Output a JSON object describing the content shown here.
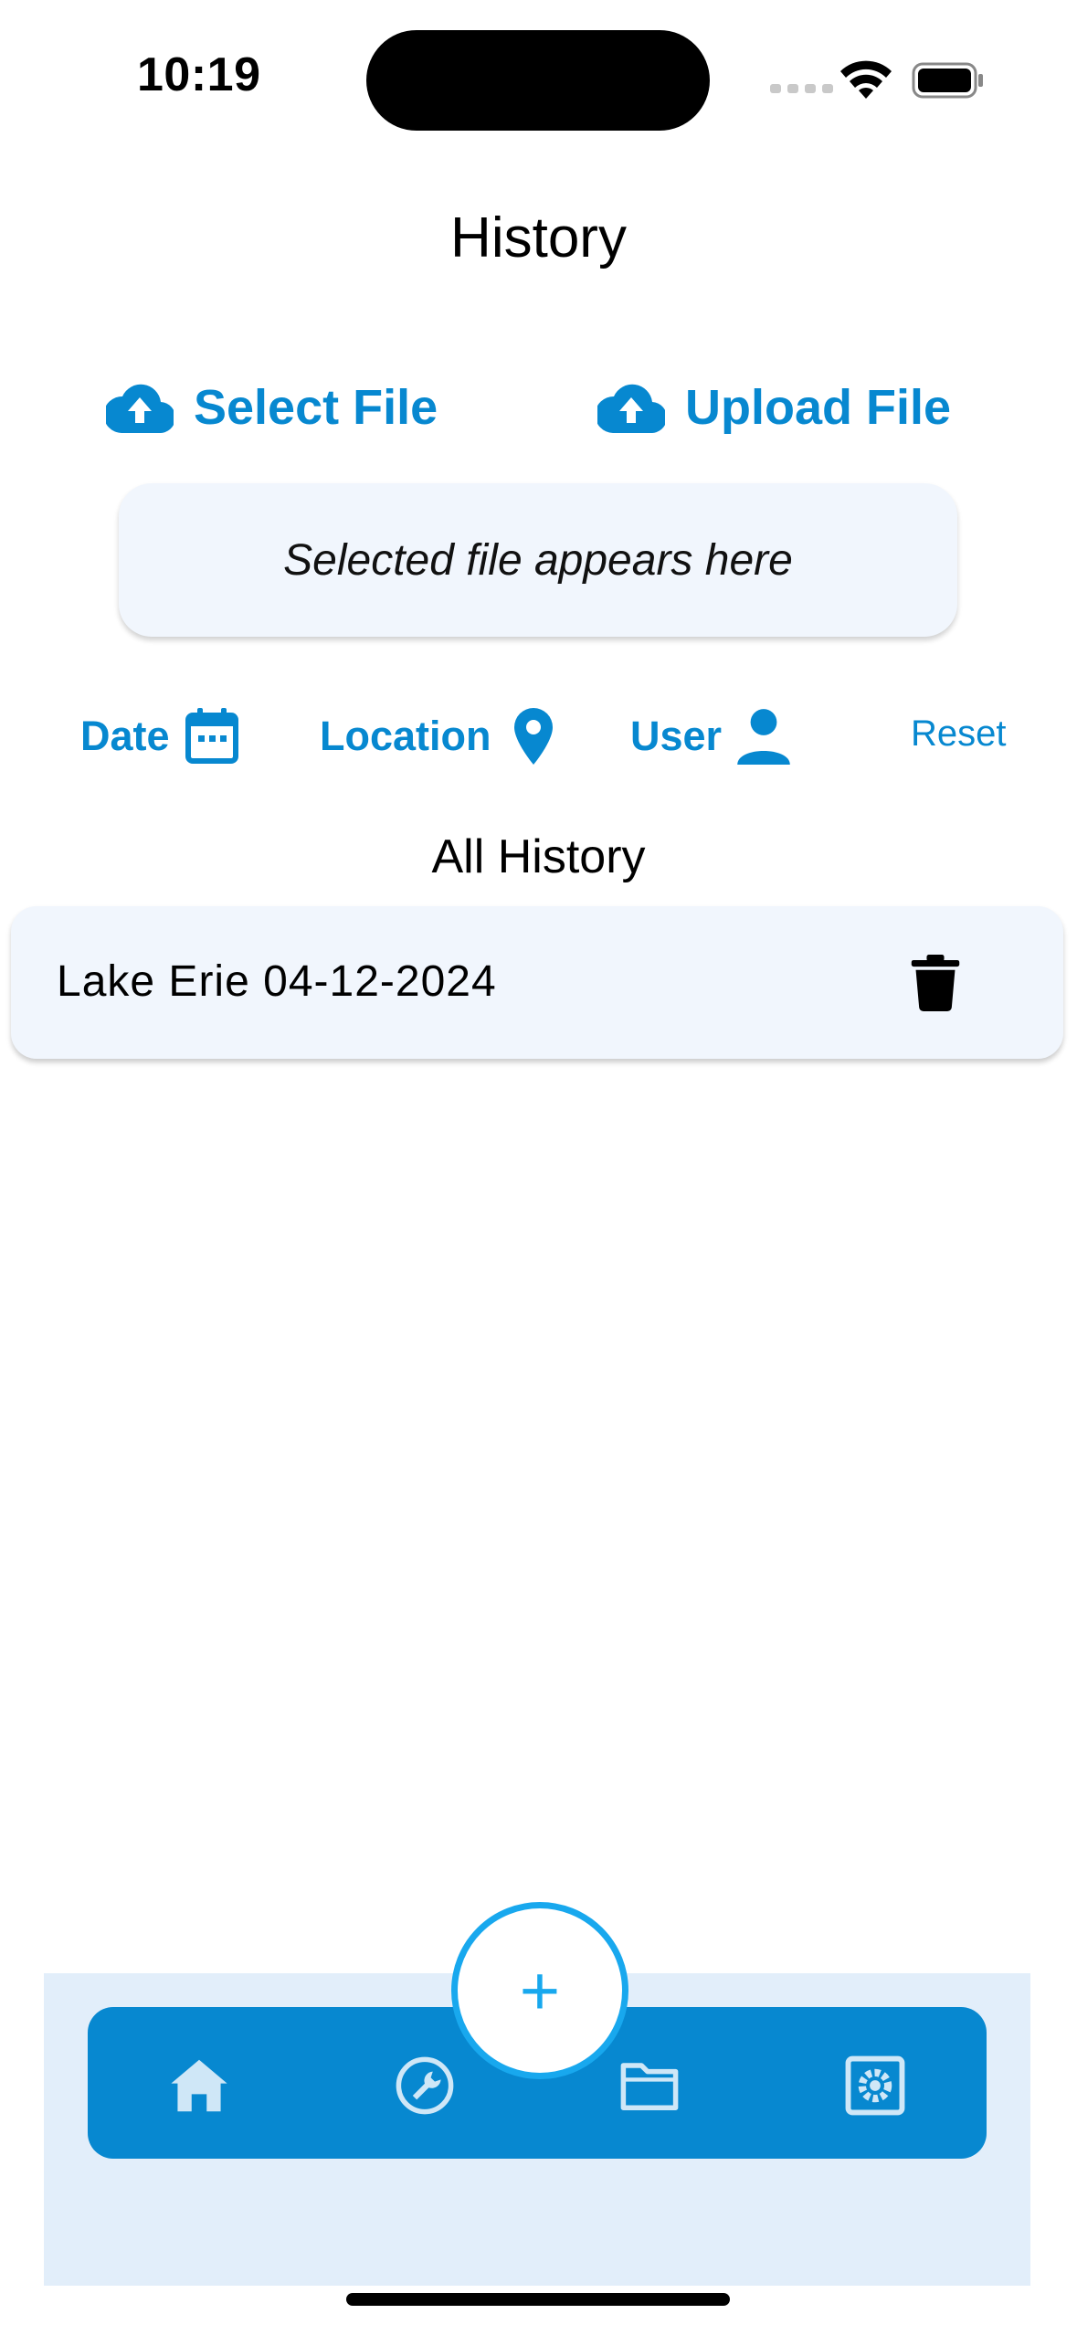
{
  "status_bar": {
    "time": "10:19"
  },
  "page": {
    "title": "History"
  },
  "actions": {
    "select_file": "Select File",
    "upload_file": "Upload File"
  },
  "file_box": {
    "placeholder": "Selected file appears here"
  },
  "filters": {
    "date": "Date",
    "location": "Location",
    "user": "User",
    "reset": "Reset"
  },
  "history": {
    "section_title": "All History",
    "items": [
      {
        "label": "Lake Erie 04-12-2024"
      }
    ]
  },
  "fab": {
    "symbol": "+"
  },
  "nav": {
    "items": [
      "home-icon",
      "wrench-icon",
      "folder-icon",
      "settings-icon"
    ]
  },
  "colors": {
    "accent": "#0788d0",
    "fab_ring": "#18a8ee",
    "card_bg": "#f1f6fd",
    "nav_bg": "#e2eefa"
  }
}
